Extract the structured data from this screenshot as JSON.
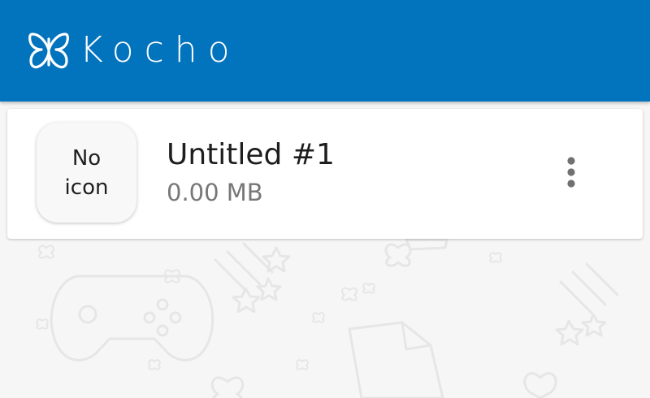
{
  "app_bar": {
    "title": "Kocho",
    "logo_icon": "butterfly-icon",
    "background_color": "#0273bd"
  },
  "games_list": {
    "items": [
      {
        "icon_placeholder": "No\nicon",
        "title": "Untitled #1",
        "size": "0.00 MB",
        "menu_icon": "more-vert-icon"
      }
    ]
  },
  "background": {
    "pattern_icons": [
      "butterfly-icon",
      "gamepad-icon",
      "star-icon",
      "shooting-star-icon",
      "file-icon"
    ],
    "color": "#f6f6f6"
  }
}
